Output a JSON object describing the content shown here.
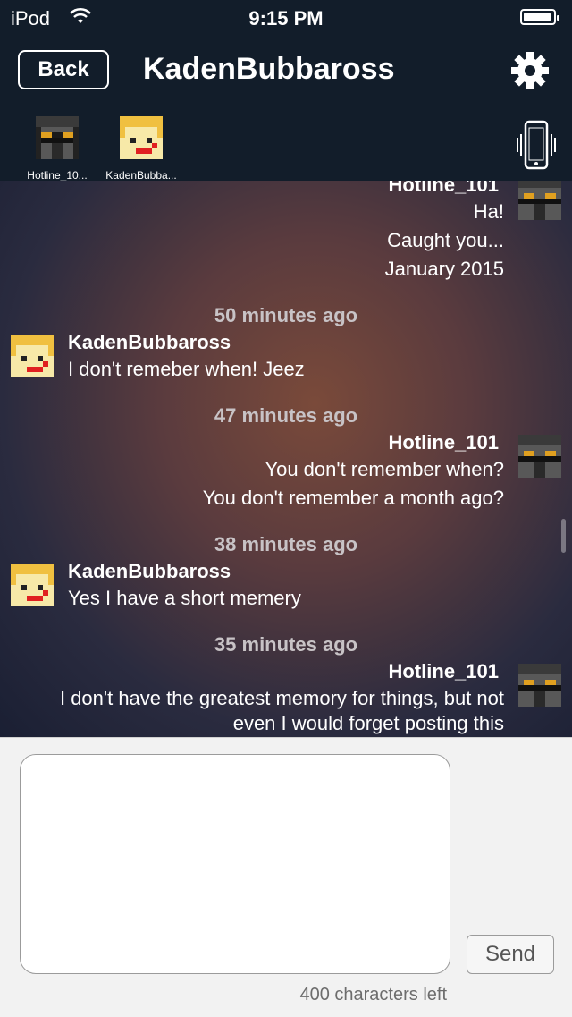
{
  "status_bar": {
    "carrier": "iPod",
    "time": "9:15 PM"
  },
  "nav": {
    "back_label": "Back",
    "title": "KadenBubbaross"
  },
  "participants": [
    {
      "name": "Hotline_10..."
    },
    {
      "name": "KadenBubba..."
    }
  ],
  "messages": {
    "m1": {
      "sender": "Hotline_101",
      "lines": [
        "Ha!",
        "Caught you...",
        "January 2015"
      ]
    },
    "t2": "50 minutes ago",
    "m2": {
      "sender": "KadenBubbaross",
      "lines": [
        "I don't remeber when! Jeez"
      ]
    },
    "t3": "47 minutes ago",
    "m3": {
      "sender": "Hotline_101",
      "lines": [
        "You don't remember when?",
        "You don't remember a month ago?"
      ]
    },
    "t4": "38 minutes ago",
    "m4": {
      "sender": "KadenBubbaross",
      "lines": [
        "Yes I have a short memery"
      ]
    },
    "t5": "35 minutes ago",
    "m5": {
      "sender": "Hotline_101",
      "lines": [
        "I don't have the greatest memory for things, but not",
        "even I would forget posting this"
      ]
    }
  },
  "compose": {
    "send_label": "Send",
    "counter": "400 characters left",
    "input_value": ""
  },
  "icons": [
    "wifi-icon",
    "battery-icon",
    "gear-icon",
    "vibrate-phone-icon"
  ]
}
